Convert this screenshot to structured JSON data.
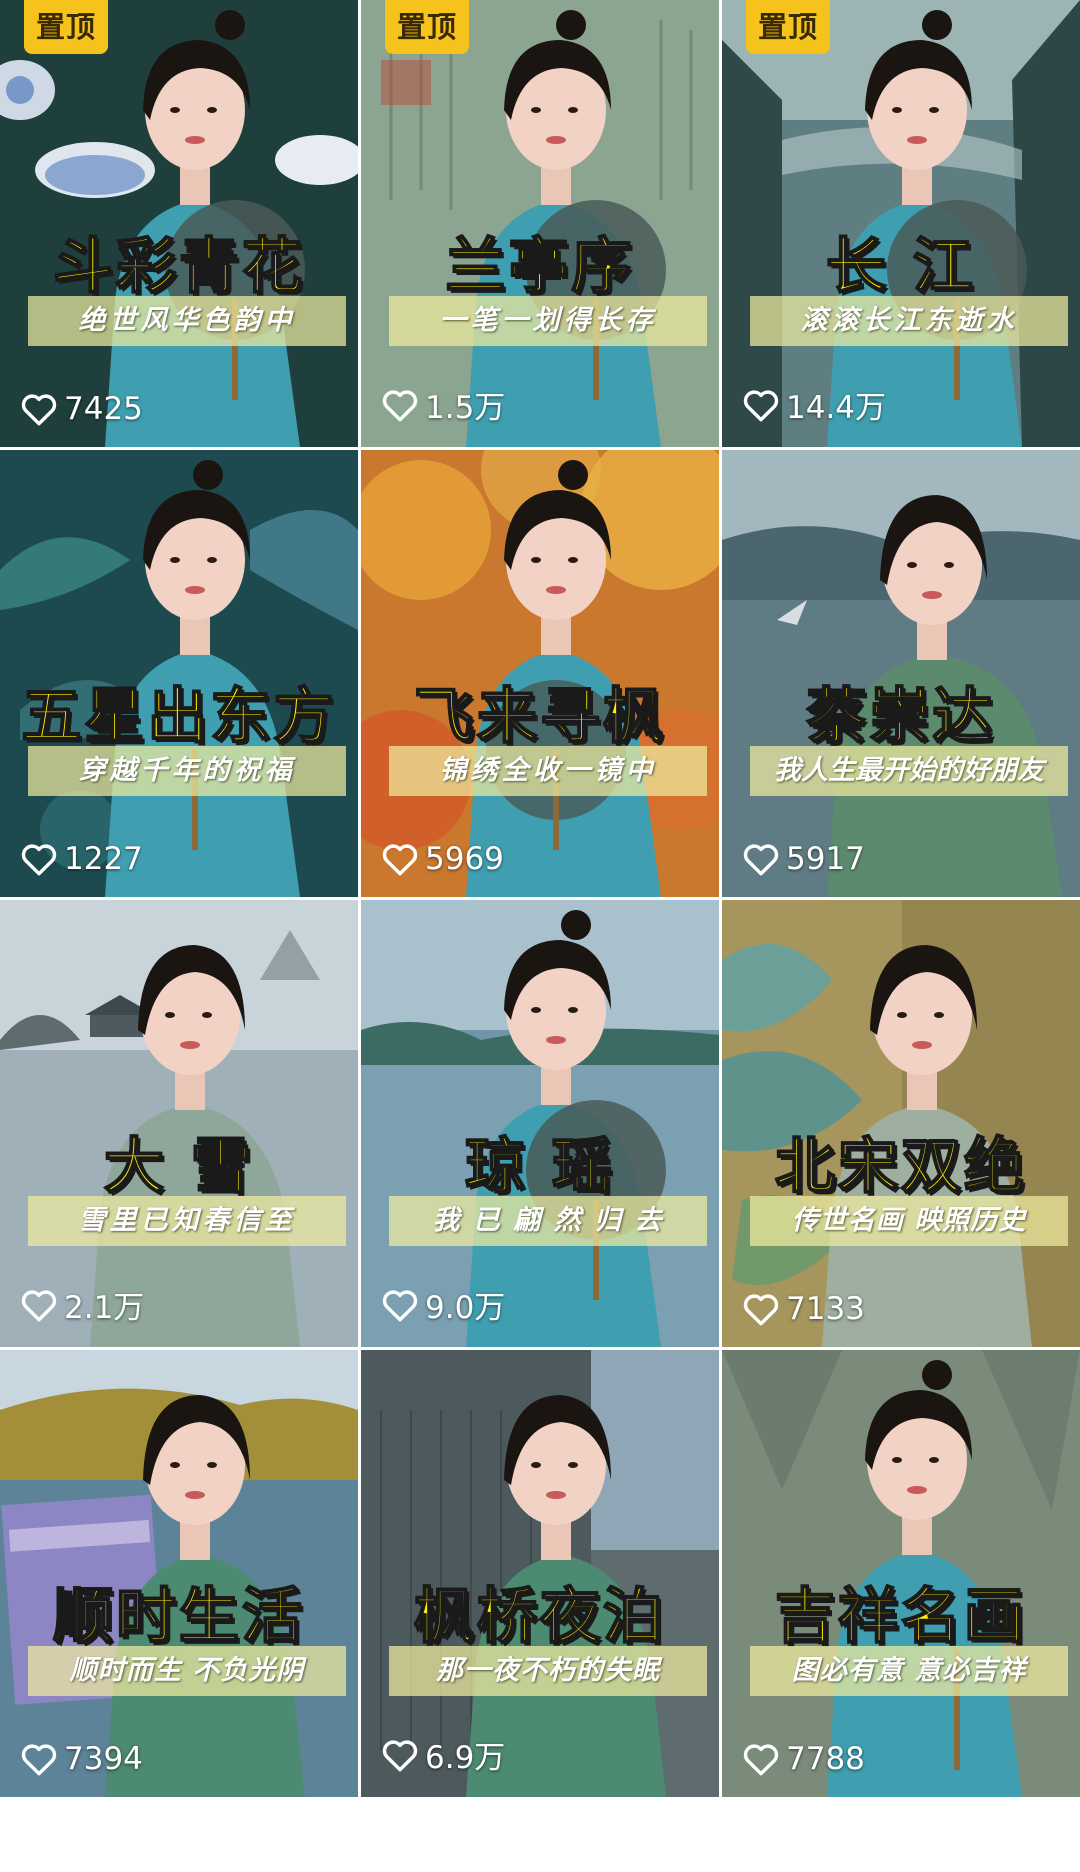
{
  "pin_label": "置顶",
  "videos": [
    {
      "title": "斗彩青花",
      "subtitle": "绝世风华色韵中",
      "likes": "7425",
      "pinned": true
    },
    {
      "title": "兰亭序",
      "subtitle": "一笔一划得长存",
      "likes": "1.5万",
      "pinned": true
    },
    {
      "title": "长 江",
      "subtitle": "滚滚长江东逝水",
      "likes": "14.4万",
      "pinned": true
    },
    {
      "title": "五星出东方",
      "subtitle": "穿越千年的祝福",
      "likes": "1227",
      "pinned": false
    },
    {
      "title": "飞来寻枫",
      "subtitle": "锦绣全收一镜中",
      "likes": "5969",
      "pinned": false
    },
    {
      "title": "蔡崇达",
      "subtitle": "我人生最开始的好朋友",
      "likes": "5917",
      "pinned": false
    },
    {
      "title": "大 雪",
      "subtitle": "雪里已知春信至",
      "likes": "2.1万",
      "pinned": false
    },
    {
      "title": "琼 瑶",
      "subtitle": "我 已 翩 然 归 去",
      "likes": "9.0万",
      "pinned": false
    },
    {
      "title": "北宋双绝",
      "subtitle": "传世名画 映照历史",
      "likes": "7133",
      "pinned": false
    },
    {
      "title": "顺时生活",
      "subtitle": "顺时而生 不负光阴",
      "likes": "7394",
      "pinned": false
    },
    {
      "title": "枫桥夜泊",
      "subtitle": "那一夜不朽的失眠",
      "likes": "6.9万",
      "pinned": false
    },
    {
      "title": "吉祥名画",
      "subtitle": "图必有意 意必吉祥",
      "likes": "7788",
      "pinned": false
    }
  ],
  "colors": {
    "pin_bg": "#f6c21c",
    "title_text": "#fff200",
    "subtitle_band": "#f0eca0"
  },
  "icons": {
    "likes": "heart-outline-icon"
  }
}
